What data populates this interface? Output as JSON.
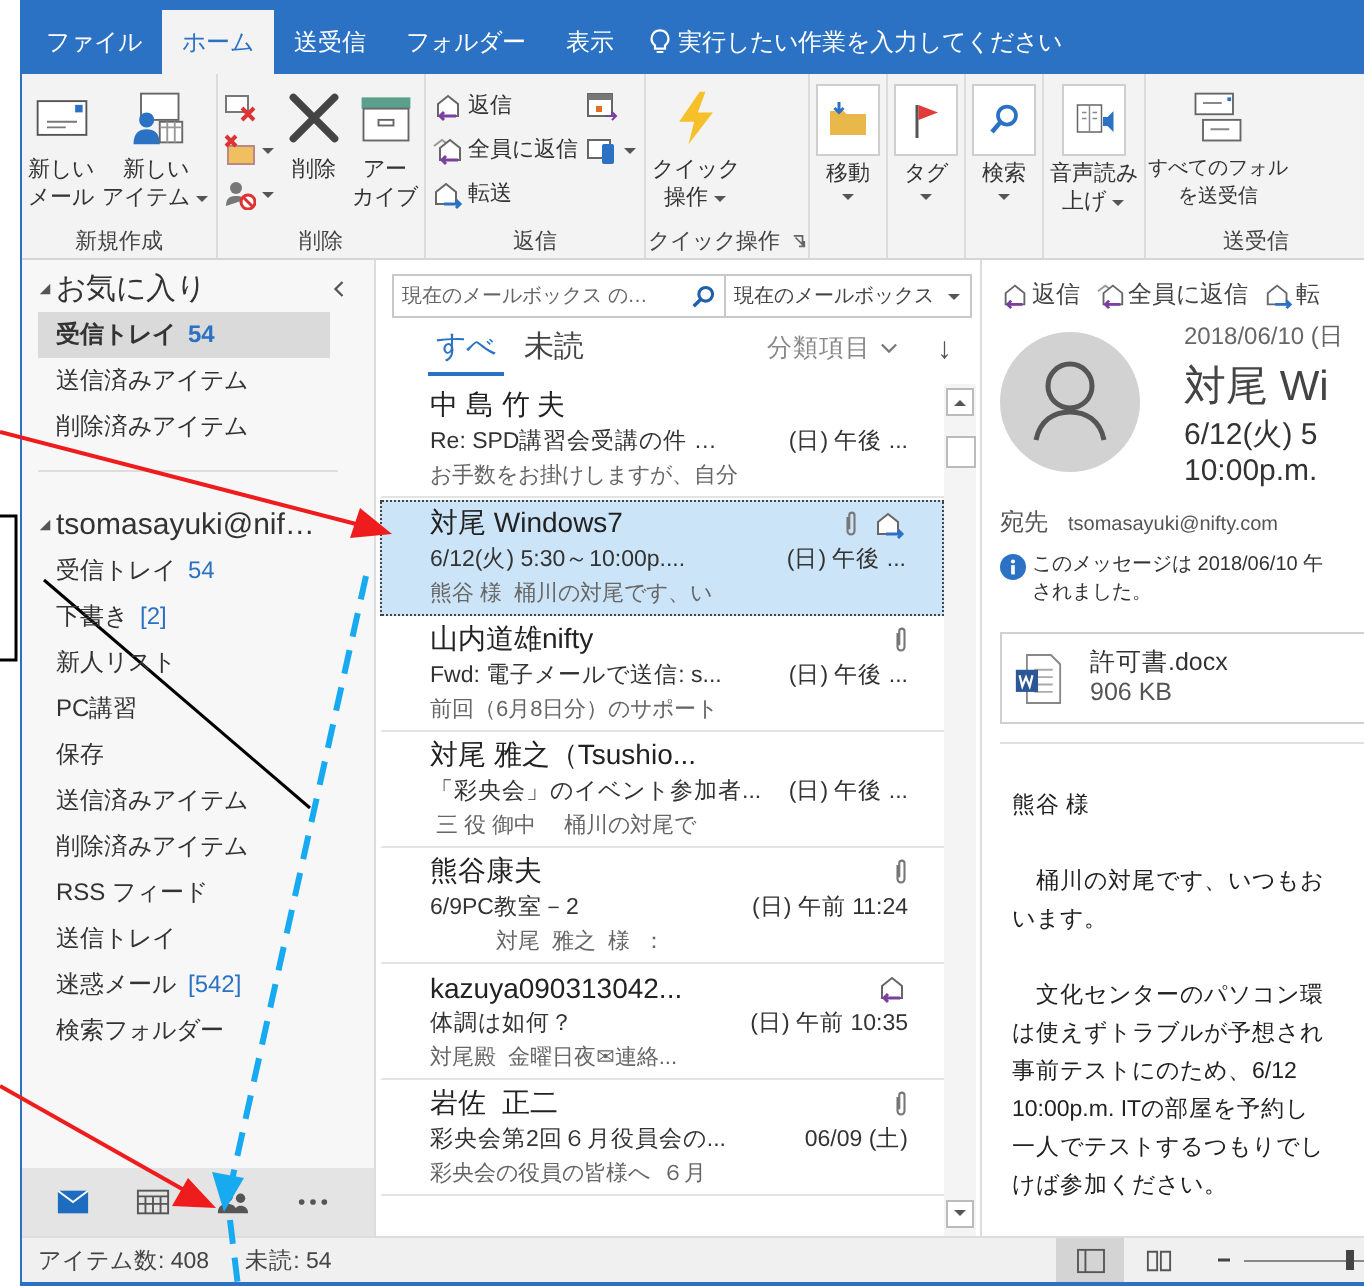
{
  "ribbon_tabs": [
    {
      "label": "ファイル",
      "selected": false
    },
    {
      "label": "ホーム",
      "selected": true
    },
    {
      "label": "送受信",
      "selected": false
    },
    {
      "label": "フォルダー",
      "selected": false
    },
    {
      "label": "表示",
      "selected": false
    }
  ],
  "tell_me": "実行したい作業を入力してください",
  "ribbon_groups": [
    {
      "label": "新規作成",
      "items": [
        {
          "kind": "large",
          "lines": [
            "新しい",
            "メール"
          ],
          "dropdown": false
        },
        {
          "kind": "large",
          "lines": [
            "新しい",
            "アイテム"
          ],
          "dropdown": true
        }
      ]
    },
    {
      "label": "削除",
      "items": [
        {
          "kind": "stack",
          "items": [
            {
              "kind": "small",
              "dropdown": false
            },
            {
              "kind": "small",
              "dropdown": true
            },
            {
              "kind": "small",
              "dropdown": true
            }
          ]
        },
        {
          "kind": "large",
          "lines": [
            "削除"
          ],
          "dropdown": false
        },
        {
          "kind": "large",
          "lines": [
            "アー",
            "カイブ"
          ],
          "dropdown": false
        }
      ]
    },
    {
      "label": "返信",
      "items": [
        {
          "kind": "stack",
          "items": [
            {
              "kind": "small",
              "text": "返信",
              "dropdown": false
            },
            {
              "kind": "small",
              "text": "全員に返信",
              "dropdown": false
            },
            {
              "kind": "small",
              "text": "転送",
              "dropdown": false
            }
          ]
        },
        {
          "kind": "stack",
          "items": [
            {
              "kind": "small",
              "dropdown": false
            },
            {
              "kind": "small",
              "dropdown": true
            }
          ]
        }
      ]
    },
    {
      "label": "クイック操作",
      "launcher": true,
      "items": [
        {
          "kind": "large",
          "lines": [
            "クイック",
            "操作"
          ],
          "dropdown": true
        }
      ]
    },
    {
      "items": [
        {
          "kind": "tile",
          "lines": [
            "移動"
          ],
          "dropdown": true
        }
      ]
    },
    {
      "items": [
        {
          "kind": "tile",
          "lines": [
            "タグ"
          ],
          "dropdown": true
        }
      ]
    },
    {
      "items": [
        {
          "kind": "tile",
          "lines": [
            "検索"
          ],
          "dropdown": true
        }
      ]
    },
    {
      "items": [
        {
          "kind": "tile",
          "lines": [
            "音声読み",
            "上げ"
          ],
          "dropdown": true
        }
      ]
    },
    {
      "label": "送受信",
      "items": [
        {
          "kind": "large",
          "lines": [
            "すべてのフォル",
            "を送受信"
          ],
          "dropdown": false
        }
      ]
    }
  ],
  "folder_pane": {
    "favorites": {
      "title": "お気に入り",
      "expanded": true,
      "items": [
        {
          "label": "受信トレイ",
          "count": "54",
          "selected": true
        },
        {
          "label": "送信済みアイテム",
          "selected": false
        },
        {
          "label": "削除済みアイテム",
          "selected": false
        }
      ]
    },
    "account": {
      "title": "tsomasayuki@nif…",
      "expanded": true,
      "items": [
        {
          "label": "受信トレイ",
          "count": "54",
          "selected": false
        },
        {
          "label": "下書き",
          "count": "[2]",
          "selected": false
        },
        {
          "label": "新人リスト",
          "selected": false
        },
        {
          "label": "PC講習",
          "selected": false
        },
        {
          "label": "保存",
          "selected": false
        },
        {
          "label": "送信済みアイテム",
          "selected": false
        },
        {
          "label": "削除済みアイテム",
          "selected": false
        },
        {
          "label": "RSS フィード",
          "selected": false
        },
        {
          "label": "送信トレイ",
          "selected": false
        },
        {
          "label": "迷惑メール",
          "count": "[542]",
          "selected": false
        },
        {
          "label": "検索フォルダー",
          "selected": false
        }
      ]
    },
    "nav": [
      {
        "selected": true
      },
      {
        "selected": false
      },
      {
        "selected": false
      },
      {
        "selected": false
      }
    ]
  },
  "message_list": {
    "search": {
      "placeholder": "現在のメールボックス の…"
    },
    "scope": "現在のメールボックス",
    "filters": [
      {
        "label": "すべ",
        "selected": true
      },
      {
        "label": "未読",
        "selected": false
      }
    ],
    "sort": "分類項目",
    "sort_arrow": "↓",
    "messages": [
      {
        "sender": "中 島 竹 夫",
        "subject": "Re: SPD講習会受講の件 …",
        "date": "(日) 午後 ...",
        "preview": "お手数をお掛けしますが、自分",
        "attachment": false,
        "forwarded": false,
        "replied": false,
        "selected": false
      },
      {
        "sender": "対尾 Windows7",
        "subject": "6/12(火) 5:30～10:00p....",
        "date": "(日) 午後 ...",
        "preview": "熊谷 様  桶川の対尾です、い",
        "attachment": true,
        "forwarded": true,
        "replied": false,
        "selected": true
      },
      {
        "sender": "山内道雄nifty",
        "subject": "Fwd: 電子メールで送信: s...",
        "date": "(日) 午後 ...",
        "preview": "前回（6月8日分）のサポート",
        "attachment": true,
        "forwarded": false,
        "replied": false,
        "selected": false
      },
      {
        "sender": "対尾 雅之（Tsushio...",
        "subject": "「彩央会」のイベント参加者...",
        "date": "(日) 午後 ...",
        "preview": " 三 役 御中　 桶川の対尾で",
        "attachment": false,
        "forwarded": false,
        "replied": false,
        "selected": false
      },
      {
        "sender": "熊谷康夫",
        "subject": "6/9PC教室－2",
        "date": "(日) 午前 11:24",
        "preview": "　　　対尾  雅之  様  ：",
        "attachment": true,
        "forwarded": false,
        "replied": false,
        "selected": false
      },
      {
        "sender": "kazuya090313042...",
        "subject": "体調は如何？",
        "date": "(日) 午前 10:35",
        "preview": "対尾殿  金曜日夜✉連絡...",
        "attachment": false,
        "forwarded": false,
        "replied": true,
        "selected": false
      },
      {
        "sender": "岩佐  正二",
        "subject": "彩央会第2回６月役員会の...",
        "date": "06/09 (土)",
        "preview": "彩央会の役員の皆様へ  ６月",
        "attachment": true,
        "forwarded": false,
        "replied": false,
        "selected": false
      }
    ]
  },
  "reading_pane": {
    "actions": [
      {
        "label": "返信",
        "kind": "reply"
      },
      {
        "label": "全員に返信",
        "kind": "reply_all"
      },
      {
        "label": "転",
        "kind": "forward"
      }
    ],
    "date": "2018/06/10 (日",
    "sender": "対尾 Wi",
    "subject_lines": [
      "6/12(火) 5",
      "10:00p.m."
    ],
    "to_label": "宛先",
    "to": "tsomasayuki@nifty.com",
    "info_lines": [
      "このメッセージは 2018/06/10 午",
      "されました。"
    ],
    "attachment": {
      "name": "許可書.docx",
      "size": "906 KB"
    },
    "body": [
      [
        "熊谷 様"
      ],
      [
        "　桶川の対尾です、いつもお",
        "います。"
      ],
      [
        "　文化センターのパソコン環",
        "は使えずトラブルが予想され",
        "事前テストにのため、6/12",
        "10:00p.m. ITの部屋を予約し",
        "一人でテストするつもりでし",
        "けば参加ください。"
      ]
    ]
  },
  "status_bar": {
    "items": "アイテム数: 408",
    "unread": "未読: 54",
    "views": [
      {
        "selected": true
      },
      {
        "selected": false
      }
    ],
    "zoom": {
      "level": 0.88
    }
  }
}
